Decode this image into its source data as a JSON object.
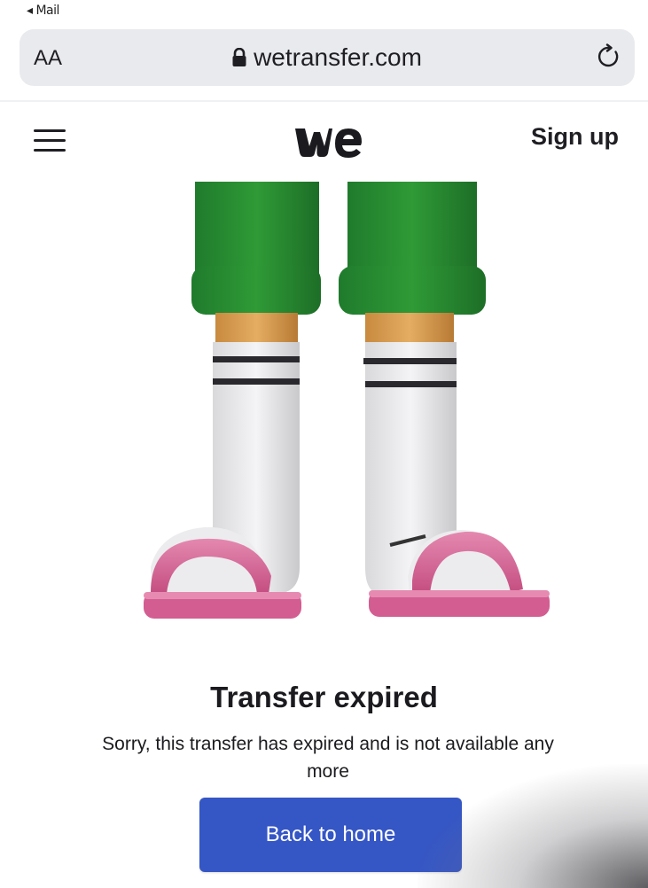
{
  "status_bar": {
    "back_label": "◂ Mail"
  },
  "browser": {
    "text_size_label": "AA",
    "url": "wetransfer.com",
    "icons": {
      "lock": "lock-icon",
      "reload": "reload-icon"
    }
  },
  "header": {
    "menu_icon": "hamburger-menu-icon",
    "logo_text": "we",
    "signup_label": "Sign up"
  },
  "content": {
    "title": "Transfer expired",
    "description": "Sorry, this transfer has expired and is not available any more",
    "button_label": "Back to home"
  },
  "colors": {
    "button_bg": "#3556c5",
    "address_bar_bg": "#e9eaee",
    "text_dark": "#1b1b1f"
  }
}
